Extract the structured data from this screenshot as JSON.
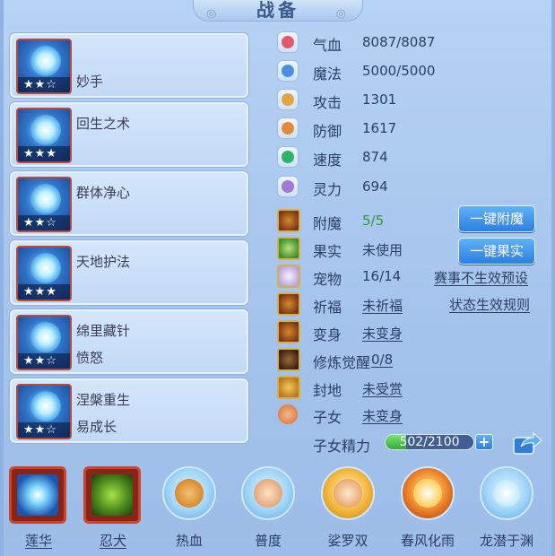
{
  "title": "战备",
  "skills": [
    {
      "name": "",
      "sub": "妙手",
      "stars": "★★☆"
    },
    {
      "name": "回生之术",
      "sub": "",
      "stars": "★★★"
    },
    {
      "name": "群体净心",
      "sub": "",
      "stars": "★★☆"
    },
    {
      "name": "天地护法",
      "sub": "",
      "stars": "★★★"
    },
    {
      "name": "绵里藏针",
      "sub": "愤怒",
      "stars": "★★☆"
    },
    {
      "name": "涅槃重生",
      "sub": "易成长",
      "stars": "★★☆"
    }
  ],
  "stats": [
    {
      "label": "气血",
      "value": "8087/8087",
      "icon": "heart-icon",
      "color": "#e25a6a"
    },
    {
      "label": "魔法",
      "value": "5000/5000",
      "icon": "mana-icon",
      "color": "#4b8fe2"
    },
    {
      "label": "攻击",
      "value": "1301",
      "icon": "sword-icon",
      "color": "#e3a640"
    },
    {
      "label": "防御",
      "value": "1617",
      "icon": "shield-icon",
      "color": "#e28c3a"
    },
    {
      "label": "速度",
      "value": "874",
      "icon": "speed-icon",
      "color": "#2fb36a"
    },
    {
      "label": "灵力",
      "value": "694",
      "icon": "spirit-icon",
      "color": "#a07ad8"
    }
  ],
  "extras": {
    "enchant": {
      "label": "附魔",
      "value": "5/5"
    },
    "fruit": {
      "label": "果实",
      "value": "未使用"
    },
    "pet": {
      "label": "宠物",
      "value": "16/14"
    },
    "blessing": {
      "label": "祈福",
      "value": "未祈福"
    },
    "transform": {
      "label": "变身",
      "value": "未变身"
    },
    "awaken": {
      "label": "修炼觉醒",
      "value": "0/8"
    },
    "fief": {
      "label": "封地",
      "value": "未受赏"
    },
    "child": {
      "label": "子女",
      "value": "未变身"
    },
    "child_energy": {
      "label": "子女精力",
      "value": "502/2100",
      "current": 502,
      "max": 2100
    }
  },
  "buttons": {
    "one_click_enchant": "一键附魔",
    "one_click_fruit": "一键果实"
  },
  "links": {
    "event_preset": "赛事不生效预设",
    "status_rules": "状态生效规则"
  },
  "bottom_skills": [
    {
      "label": "莲华",
      "icon": "lotus-icon",
      "underline": true
    },
    {
      "label": "忍犬",
      "icon": "wolf-icon",
      "underline": true
    },
    {
      "label": "热血",
      "icon": "hotblood-icon",
      "underline": false
    },
    {
      "label": "普度",
      "icon": "palm-icon",
      "underline": false
    },
    {
      "label": "娑罗双",
      "icon": "fist-icon",
      "underline": false
    },
    {
      "label": "春风化雨",
      "icon": "fire-burst-icon",
      "underline": false
    },
    {
      "label": "龙潜于渊",
      "icon": "dragon-icon",
      "underline": false
    }
  ],
  "colors": {
    "accent_green": "#2f9a3a",
    "button_blue": "#2c7fe0"
  }
}
